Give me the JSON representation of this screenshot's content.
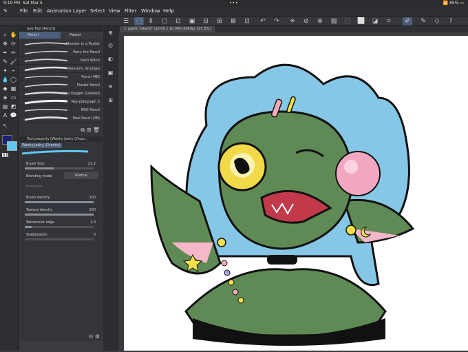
{
  "status": {
    "time": "9:19 PM",
    "date": "Sat Mar 5",
    "dots": "•••",
    "battery": "65%"
  },
  "menu": [
    "File",
    "Edit",
    "Animation",
    "Layer",
    "Select",
    "View",
    "Filter",
    "Window",
    "Help"
  ],
  "subtool": {
    "header": "Sub Tool [Pencil]",
    "tabs": [
      "Pencil",
      "Pastel"
    ],
    "brushes": [
      "Monster in a Pocket",
      "Perry the Pencil",
      "Paint Witch",
      "Painterly (Grunge)",
      "Pencil (4B)",
      "Plaster Pencil",
      "Pri's Dagger (Loaded)",
      "Ray-pidograph 2",
      "RNG Pencil",
      "Real Pencil (2B)"
    ]
  },
  "toolprop": {
    "header": "Tool property [Washy Joshy (Chao...",
    "name": "Washy Joshy (Chaotic)",
    "brush_size": {
      "label": "Brush Size",
      "value": "21.2",
      "level": 0.42
    },
    "blending": {
      "label": "Blending mode",
      "value": "Normal"
    },
    "hardness": {
      "label": "Hardness"
    },
    "brush_density": {
      "label": "Brush density",
      "value": "100",
      "level": 1.0
    },
    "texture_density": {
      "label": "Texture density",
      "value": "100",
      "level": 1.0
    },
    "watercolor_edge": {
      "label": "Watercolor edge",
      "value": "1.0",
      "level": 0.1
    },
    "stabilization": {
      "label": "Stabilization",
      "value": "0",
      "level": 0.0
    }
  },
  "canvas": {
    "tab": "goblin tokens* (10.00 x 10.00in 600dpi 107.3%)"
  },
  "colors": {
    "main": "#1d2172",
    "sub": "#5ec8f2"
  }
}
